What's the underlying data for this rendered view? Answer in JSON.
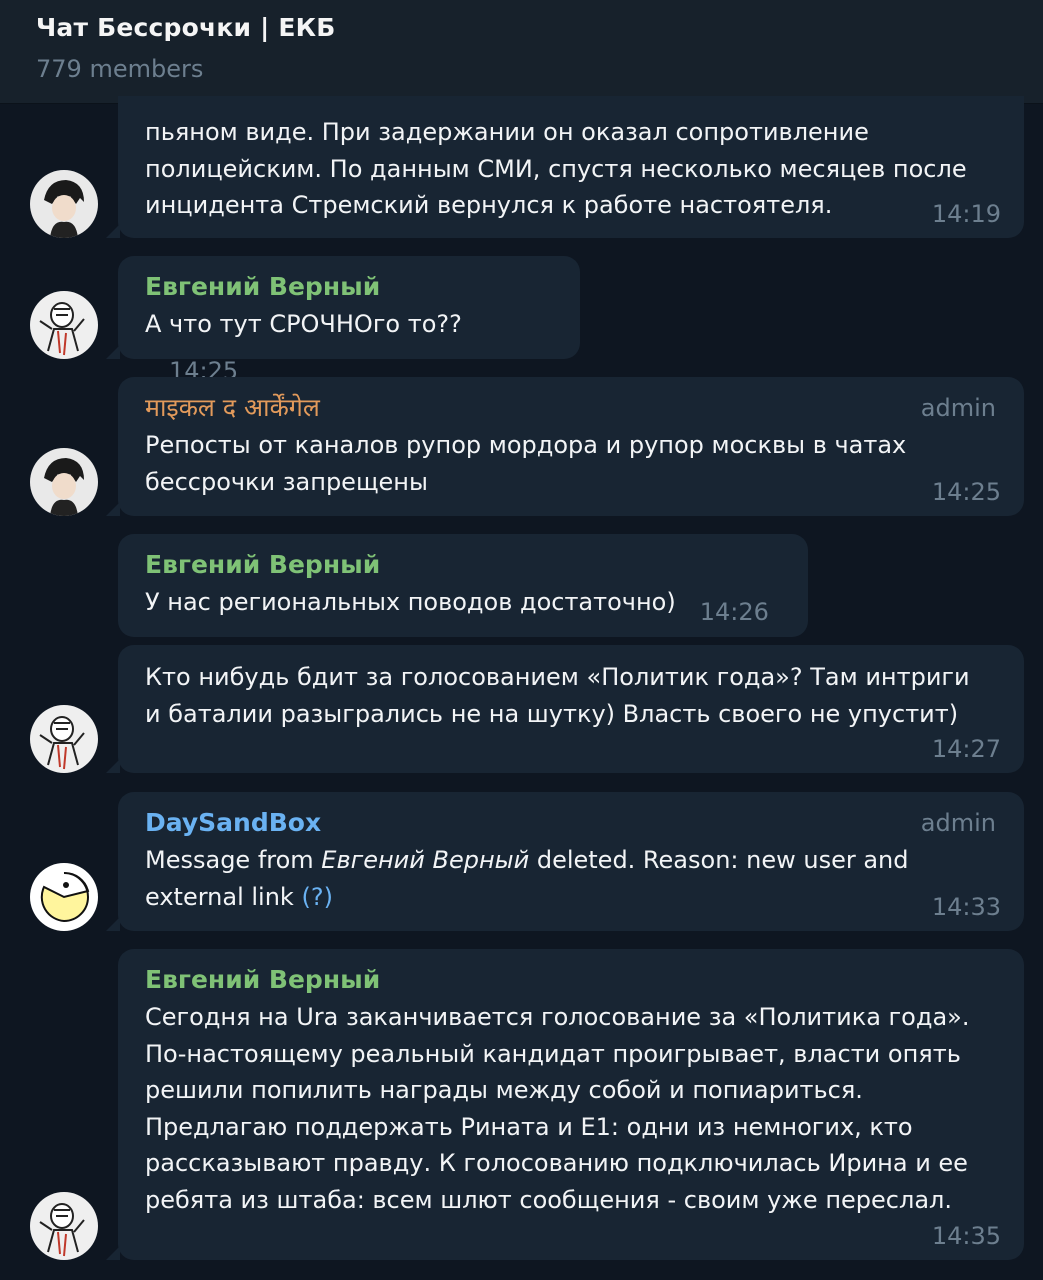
{
  "header": {
    "title": "Чат Бессрочки | ЕКБ",
    "members": "779 members"
  },
  "messages": [
    {
      "text_lines": [
        "пьяном виде. При задержании он оказал сопротивление",
        "полицейским. По данным СМИ, спустя несколько месяцев после",
        "инцидента Стремский вернулся к работе настоятеля."
      ],
      "time": "14:19"
    },
    {
      "sender": "Евгений Верный",
      "text": "А что тут СРОЧНОго то??",
      "time": "14:25"
    },
    {
      "sender": "माइकल द आर्केंगेल",
      "role": "admin",
      "text_lines": [
        "Репосты от каналов рупор мордора и рупор москвы в чатах",
        "бессрочки запрещены"
      ],
      "time": "14:25"
    },
    {
      "sender": "Евгений Верный",
      "text": "У нас региональных поводов достаточно)",
      "time": "14:26"
    },
    {
      "text_lines": [
        "Кто нибудь бдит за голосованием «Политик года»? Там интриги",
        "и баталии разыгрались не на шутку) Власть своего не упустит)"
      ],
      "time": "14:27"
    },
    {
      "sender": "DaySandBox",
      "role": "admin",
      "text_prefix": "Message from ",
      "text_italic": "Евгений Верный",
      "text_suffix": " deleted. Reason: new user and",
      "text_line2": "external link ",
      "help": "(?)",
      "time": "14:33"
    },
    {
      "sender": "Евгений Верный",
      "text_lines": [
        "Сегодня на Ura заканчивается голосование за «Политика года».",
        "По-настоящему реальный кандидат проигрывает, власти опять",
        "решили попилить награды между собой и попиариться.",
        "Предлагаю поддержать Рината и Е1: одни из немногих, кто",
        "рассказывают правду. К голосованию подключилась Ирина и ее",
        "ребята из штаба: всем шлют сообщения - своим уже переслал."
      ],
      "time": "14:35"
    }
  ],
  "colors": {
    "background": "#0e1621",
    "bubble": "#182533",
    "sender_green": "#7fc276",
    "sender_orange": "#e29a5b",
    "sender_blue": "#6ab2f2",
    "muted": "#6d7f8f"
  }
}
